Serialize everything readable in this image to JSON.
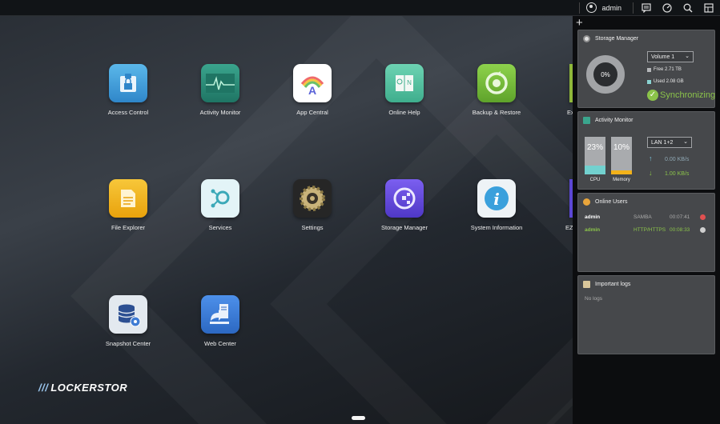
{
  "topbar": {
    "username": "admin",
    "icons": [
      "user-icon",
      "notifications-icon",
      "dashboard-icon",
      "search-icon",
      "widgets-icon"
    ]
  },
  "apps": [
    {
      "label": "Access Control",
      "icon": "access-control-icon",
      "color": "#4aa3df"
    },
    {
      "label": "Activity Monitor",
      "icon": "activity-monitor-icon",
      "color": "#2c8f7a"
    },
    {
      "label": "App Central",
      "icon": "app-central-icon",
      "color": "#ffffff"
    },
    {
      "label": "Online Help",
      "icon": "online-help-icon",
      "color": "#5cc8a8"
    },
    {
      "label": "Backup & Restore",
      "icon": "backup-restore-icon",
      "color": "#7cc242"
    },
    {
      "label": "Ex",
      "icon": "external-devices-icon",
      "color": "#8fb83a"
    },
    {
      "label": "File Explorer",
      "icon": "file-explorer-icon",
      "color": "#f2b21a"
    },
    {
      "label": "Services",
      "icon": "services-icon",
      "color": "#dff1f4"
    },
    {
      "label": "Settings",
      "icon": "settings-icon",
      "color": "#2b2b2b"
    },
    {
      "label": "Storage Manager",
      "icon": "storage-manager-icon",
      "color": "#6a4ed8"
    },
    {
      "label": "System Information",
      "icon": "system-information-icon",
      "color": "#e8eef2"
    },
    {
      "label": "EZ",
      "icon": "ez-connect-icon",
      "color": "#5b47d4"
    },
    {
      "label": "Snapshot Center",
      "icon": "snapshot-center-icon",
      "color": "#dfe6ee"
    },
    {
      "label": "Web Center",
      "icon": "web-center-icon",
      "color": "#3d7fd9"
    }
  ],
  "logo": {
    "text": "LOCKERSTOR",
    "mark": "///"
  },
  "sidepanel": {
    "add_label": "+",
    "storage": {
      "title": "Storage Manager",
      "usage_percent": "0%",
      "volume": "Volume 1",
      "free": "Free 2.71 TB",
      "used": "Used 2.08 GB",
      "status": "Synchronizing",
      "status_color": "#8bc34a"
    },
    "activity": {
      "title": "Activity Monitor",
      "cpu_value": "23%",
      "cpu_fraction": 0.23,
      "cpu_label": "CPU",
      "memory_value": "10%",
      "memory_fraction": 0.1,
      "memory_label": "Memory",
      "interface": "LAN 1+2",
      "upload": "0.00 KB/s",
      "download": "1.00 KB/s"
    },
    "users": {
      "title": "Online Users",
      "rows": [
        {
          "user": "admin",
          "protocol": "SAMBA",
          "time": "00:07:41",
          "user_color": "#ffffff",
          "proto_color": "#aaaaaa",
          "status_color": "#e05050"
        },
        {
          "user": "admin",
          "protocol": "HTTP/HTTPS",
          "time": "00:08:33",
          "user_color": "#8bc34a",
          "proto_color": "#8bc34a",
          "status_color": "#cfcfcf"
        }
      ]
    },
    "logs": {
      "title": "Important logs",
      "empty_text": "No logs"
    }
  }
}
